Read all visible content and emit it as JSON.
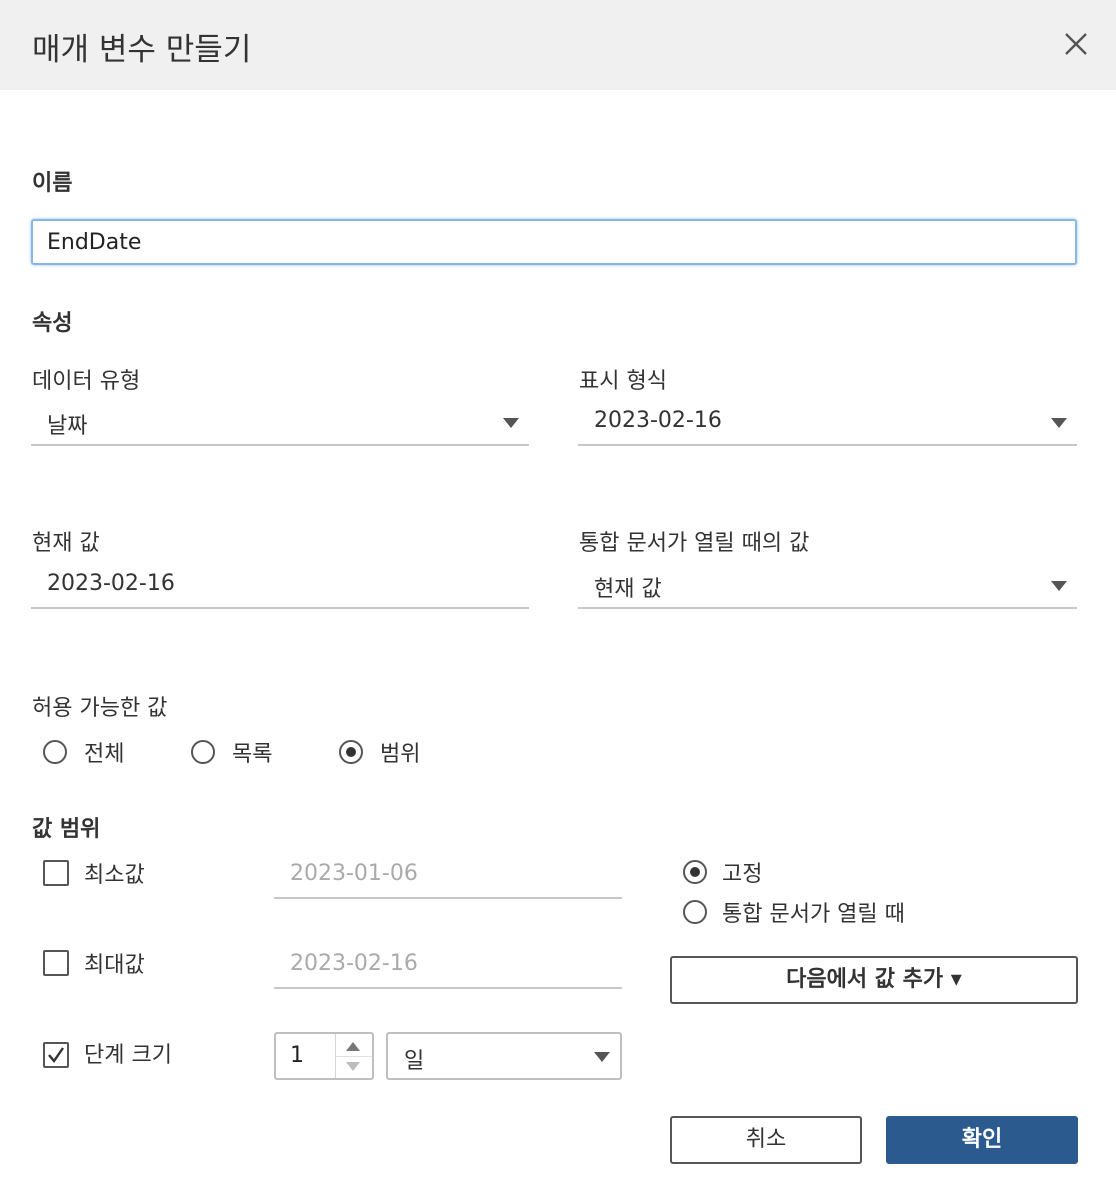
{
  "dialog": {
    "title": "매개 변수 만들기"
  },
  "name_section": {
    "label": "이름",
    "value": "EndDate"
  },
  "properties": {
    "label": "속성",
    "data_type": {
      "label": "데이터 유형",
      "value": "날짜"
    },
    "display_format": {
      "label": "표시 형식",
      "value": "2023-02-16"
    },
    "current_value": {
      "label": "현재 값",
      "value": "2023-02-16"
    },
    "workbook_open_value": {
      "label": "통합 문서가 열릴 때의 값",
      "value": "현재 값"
    }
  },
  "allowable_values": {
    "label": "허용 가능한 값",
    "options": [
      "전체",
      "목록",
      "범위"
    ],
    "selected": "범위"
  },
  "range": {
    "label": "값 범위",
    "minimum": {
      "label": "최소값",
      "value": "2023-01-06",
      "checked": false
    },
    "maximum": {
      "label": "최대값",
      "value": "2023-02-16",
      "checked": false
    },
    "step_size": {
      "label": "단계 크기",
      "value": "1",
      "unit": "일",
      "checked": true
    },
    "mode_options": [
      "고정",
      "통합 문서가 열릴 때"
    ],
    "mode_selected": "고정",
    "add_values_from_label": "다음에서 값 추가 ▾"
  },
  "buttons": {
    "cancel": "취소",
    "ok": "확인"
  },
  "icons": {
    "close": "close-icon",
    "dropdown": "chevron-down-icon",
    "check": "check-icon"
  },
  "colors": {
    "primary_button": "#2b5b8e",
    "input_focus": "#8ab6e5",
    "title_bar": "#f0f0f0"
  }
}
